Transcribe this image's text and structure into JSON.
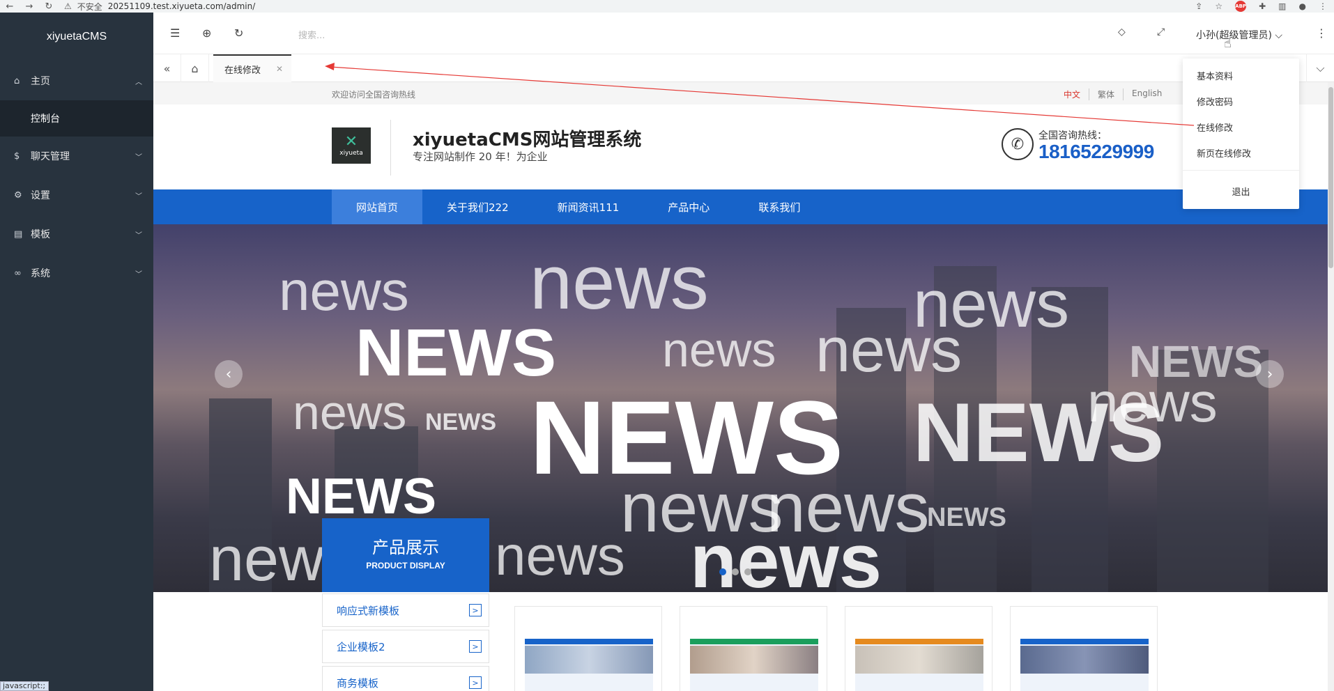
{
  "browser": {
    "security": "不安全",
    "url": "20251109.test.xiyueta.com/admin/",
    "abp": "ABP"
  },
  "sidebar": {
    "logo": "xiyuetaCMS",
    "items": [
      {
        "label": "主页",
        "icon": "home-icon",
        "glyph": "⌂",
        "expanded": true
      },
      {
        "label": "聊天管理",
        "icon": "dollar-icon",
        "glyph": "$"
      },
      {
        "label": "设置",
        "icon": "gear-icon",
        "glyph": "⚙"
      },
      {
        "label": "模板",
        "icon": "template-icon",
        "glyph": "▤"
      },
      {
        "label": "系统",
        "icon": "link-icon",
        "glyph": "∞"
      }
    ],
    "submenu": [
      "控制台"
    ]
  },
  "topbar": {
    "search_placeholder": "搜索...",
    "user": "小孙(超级管理员)",
    "user_chevron": "⌵"
  },
  "tabs": {
    "active": "在线修改"
  },
  "dropdown": {
    "items": [
      "基本资料",
      "修改密码",
      "在线修改",
      "新页在线修改"
    ],
    "logout": "退出"
  },
  "site": {
    "welcome": "欢迎访问全国咨询热线",
    "langs": [
      "中文",
      "繁体",
      "English"
    ],
    "title": "xiyuetaCMS网站管理系统",
    "subtitle": "专注网站制作 20 年！为企业",
    "logo_word": "xiyueta",
    "hotline_label": "全国咨询热线：",
    "hotline": "18165229999",
    "nav": [
      "网站首页",
      "关于我们222",
      "新闻资讯111",
      "产品中心",
      "联系我们"
    ],
    "banner_words": [
      "news",
      "NEWS"
    ],
    "product_title": "产品展示",
    "product_subtitle": "PRODUCT DISPLAY",
    "products": [
      "响应式新模板",
      "企业模板2",
      "商务模板"
    ]
  },
  "status": "javascript:;",
  "colors": {
    "sidebar_bg": "#28333e",
    "brand_blue": "#1763c9",
    "active_lang": "#d9342b",
    "arrow": "#e53935"
  }
}
